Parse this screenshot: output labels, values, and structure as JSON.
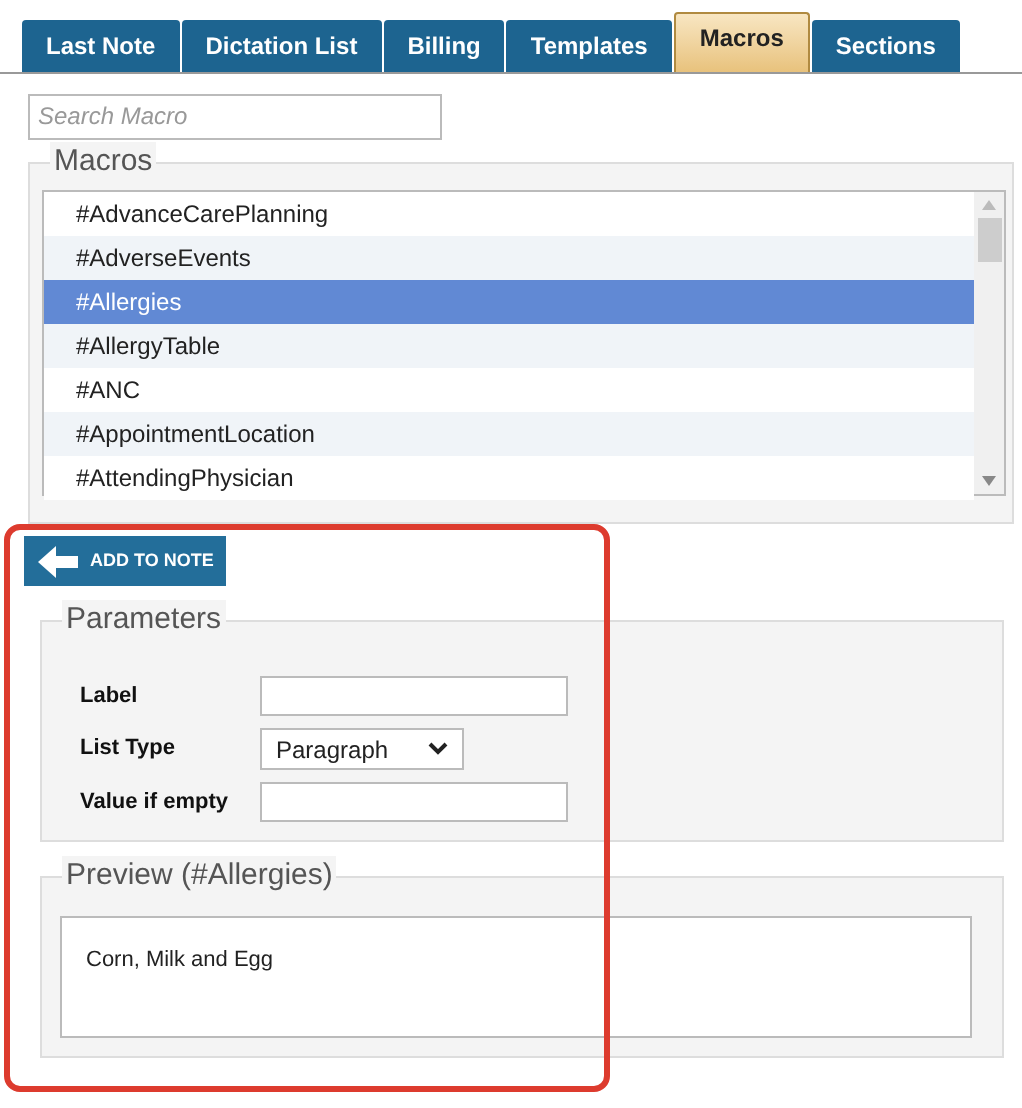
{
  "tabs": [
    {
      "label": "Last Note",
      "selected": false
    },
    {
      "label": "Dictation List",
      "selected": false
    },
    {
      "label": "Billing",
      "selected": false
    },
    {
      "label": "Templates",
      "selected": false
    },
    {
      "label": "Macros",
      "selected": true
    },
    {
      "label": "Sections",
      "selected": false
    }
  ],
  "search": {
    "placeholder": "Search Macro"
  },
  "macros": {
    "title": "Macros",
    "items": [
      {
        "label": "#AdvanceCarePlanning",
        "selected": false
      },
      {
        "label": "#AdverseEvents",
        "selected": false
      },
      {
        "label": "#Allergies",
        "selected": true
      },
      {
        "label": "#AllergyTable",
        "selected": false
      },
      {
        "label": "#ANC",
        "selected": false
      },
      {
        "label": "#AppointmentLocation",
        "selected": false
      },
      {
        "label": "#AttendingPhysician",
        "selected": false
      }
    ]
  },
  "add_button": "ADD TO NOTE",
  "parameters": {
    "title": "Parameters",
    "fields": [
      {
        "label": "Label",
        "kind": "text"
      },
      {
        "label": "List Type",
        "kind": "select",
        "value": "Paragraph"
      },
      {
        "label": "Value if empty",
        "kind": "text"
      }
    ]
  },
  "preview": {
    "title": "Preview (#Allergies)",
    "text": "Corn, Milk and Egg"
  }
}
